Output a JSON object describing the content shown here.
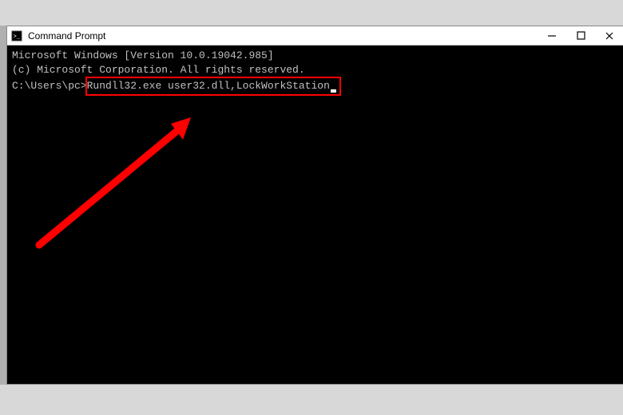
{
  "window": {
    "title": "Command Prompt"
  },
  "terminal": {
    "line1": "Microsoft Windows [Version 10.0.19042.985]",
    "line2": "(c) Microsoft Corporation. All rights reserved.",
    "blank": "",
    "prompt": "C:\\Users\\pc>",
    "command": "Rundll32.exe user32.dll,LockWorkStation"
  }
}
